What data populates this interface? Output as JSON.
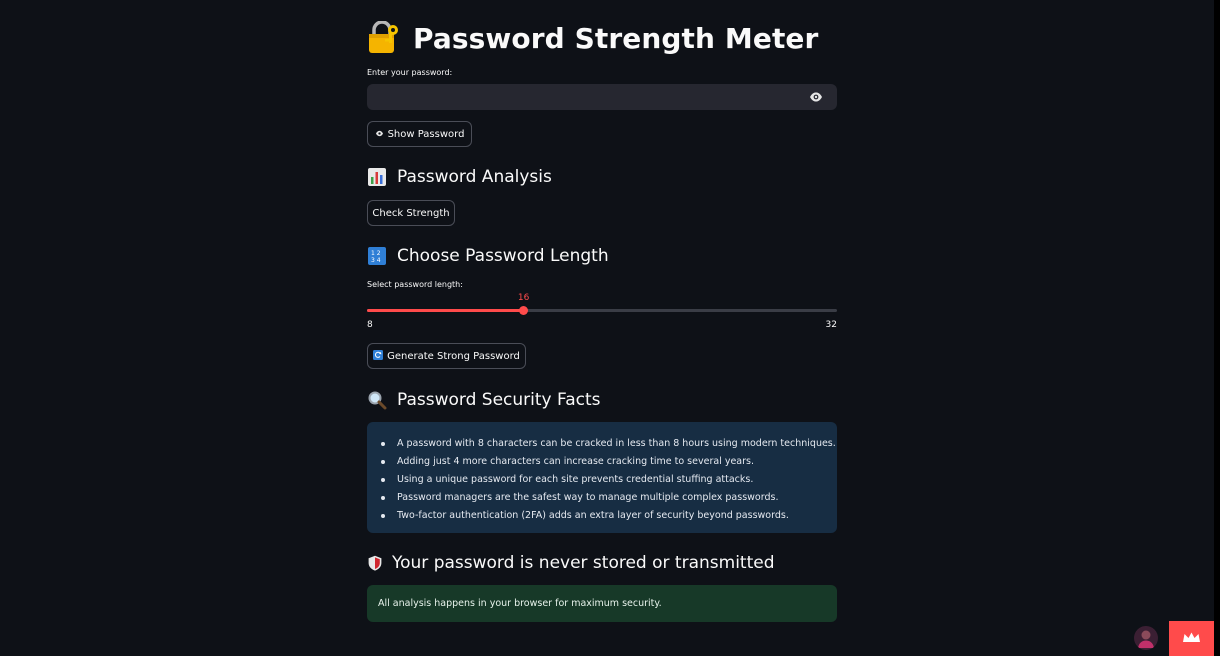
{
  "title": "Password Strength Meter",
  "password_input": {
    "label": "Enter your password:",
    "value": "",
    "placeholder": ""
  },
  "show_password_button": "Show Password",
  "analysis": {
    "heading": "Password Analysis",
    "check_button": "Check Strength"
  },
  "length_section": {
    "heading": "Choose Password Length",
    "slider_label": "Select password length:",
    "value": 16,
    "min": 8,
    "max": 32,
    "value_text": "16",
    "min_text": "8",
    "max_text": "32",
    "generate_button": "Generate Strong Password"
  },
  "facts": {
    "heading": "Password Security Facts",
    "items": [
      "A password with 8 characters can be cracked in less than 8 hours using modern techniques.",
      "Adding just 4 more characters can increase cracking time to several years.",
      "Using a unique password for each site prevents credential stuffing attacks.",
      "Password managers are the safest way to manage multiple complex passwords.",
      "Two-factor authentication (2FA) adds an extra layer of security beyond passwords."
    ]
  },
  "privacy": {
    "heading": "Your password is never stored or transmitted",
    "message": "All analysis happens in your browser for maximum security."
  },
  "icons": {
    "title": "locked-with-key-icon",
    "eye": "eye-icon",
    "analysis": "bar-chart-icon",
    "length": "input-numbers-icon",
    "generate": "refresh-icon",
    "facts": "magnifying-glass-icon",
    "privacy": "shield-icon"
  },
  "colors": {
    "background": "#0e1117",
    "accent": "#ff4b4b",
    "info_bg": "#172d43",
    "success_bg": "#173928",
    "input_bg": "#262730"
  }
}
